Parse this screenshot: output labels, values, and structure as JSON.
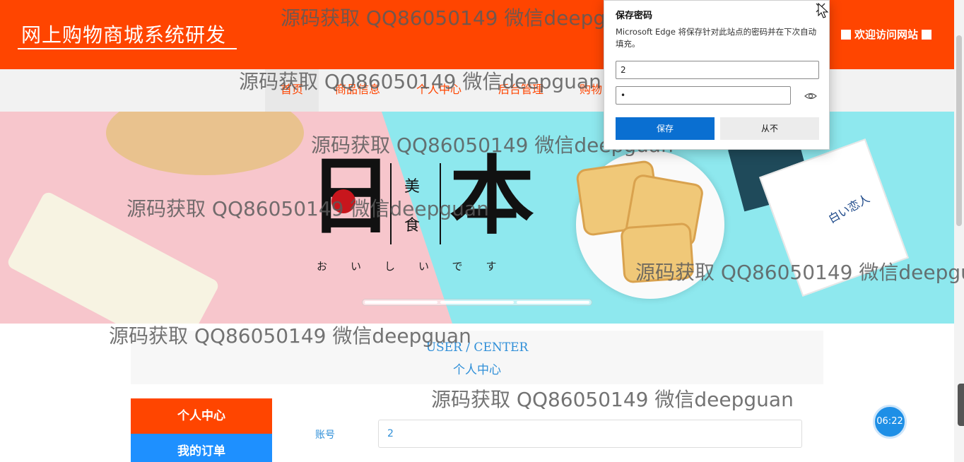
{
  "header": {
    "site_title": "网上购物商城系统研发",
    "welcome": "欢迎访问网站",
    "bg_color": "#ff4500"
  },
  "nav": {
    "items": [
      {
        "label": "首页"
      },
      {
        "label": "商品信息"
      },
      {
        "label": "个人中心"
      },
      {
        "label": "后台管理"
      },
      {
        "label": "购物"
      }
    ]
  },
  "banner": {
    "big_left": "日",
    "big_right": "本",
    "small_top": "美",
    "small_bottom": "食",
    "kana": "おいしいです",
    "packet_text": "白い恋人"
  },
  "user_center": {
    "title_en": "USER / CENTER",
    "title_zh": "个人中心"
  },
  "sidebar": {
    "personal": "个人中心",
    "orders": "我的订单"
  },
  "form": {
    "account_label": "账号",
    "account_value": "2"
  },
  "timer": "06:22",
  "popup": {
    "title": "保存密码",
    "description": "Microsoft Edge 将保存针对此站点的密码并在下次自动填充。",
    "username": "2",
    "password": "•",
    "save_label": "保存",
    "never_label": "从不",
    "save_color": "#0a6fd1"
  },
  "watermark": "源码获取 QQ86050149 微信deepguan",
  "icons": [
    "close-icon",
    "eye-icon",
    "cursor-icon"
  ]
}
